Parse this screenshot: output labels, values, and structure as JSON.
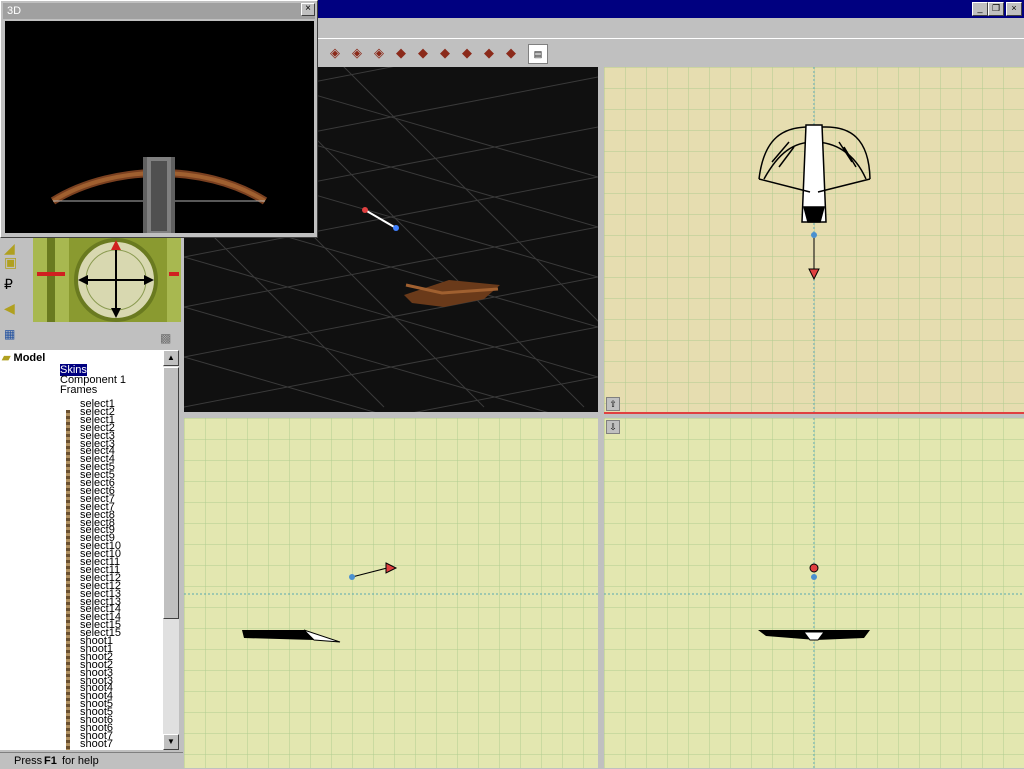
{
  "window": {
    "floating_3d_title": "3D",
    "close_glyph": "×"
  },
  "toolbar": {
    "icons": [
      "move-icon",
      "rotate-icon",
      "scale-icon",
      "vertex-icon",
      "edge-icon",
      "face-icon",
      "bone-icon",
      "tag-icon",
      "animate-icon",
      "document-icon"
    ]
  },
  "tree": {
    "root": "Model",
    "items": [
      {
        "label": "Skins",
        "selected": true
      },
      {
        "label": "Component 1"
      },
      {
        "label": "Frames"
      },
      {
        "label": "select1"
      },
      {
        "label": "select2"
      },
      {
        "label": "select1"
      },
      {
        "label": "select2"
      },
      {
        "label": "select3"
      },
      {
        "label": "select3"
      },
      {
        "label": "select4"
      },
      {
        "label": "select4"
      },
      {
        "label": "select5"
      },
      {
        "label": "select5"
      },
      {
        "label": "select6"
      },
      {
        "label": "select6"
      },
      {
        "label": "select7"
      },
      {
        "label": "select7"
      },
      {
        "label": "select8"
      },
      {
        "label": "select8"
      },
      {
        "label": "select9"
      },
      {
        "label": "select9"
      },
      {
        "label": "select10"
      },
      {
        "label": "select10"
      },
      {
        "label": "select11"
      },
      {
        "label": "select11"
      },
      {
        "label": "select12"
      },
      {
        "label": "select12"
      },
      {
        "label": "select13"
      },
      {
        "label": "select13"
      },
      {
        "label": "select14"
      },
      {
        "label": "select14"
      },
      {
        "label": "select15"
      },
      {
        "label": "select15"
      },
      {
        "label": "shoot1"
      },
      {
        "label": "shoot1"
      },
      {
        "label": "shoot2"
      },
      {
        "label": "shoot2"
      },
      {
        "label": "shoot3"
      },
      {
        "label": "shoot3"
      },
      {
        "label": "shoot4"
      },
      {
        "label": "shoot4"
      },
      {
        "label": "shoot5"
      },
      {
        "label": "shoot5"
      },
      {
        "label": "shoot6"
      },
      {
        "label": "shoot6"
      },
      {
        "label": "shoot7"
      },
      {
        "label": "shoot7"
      }
    ]
  },
  "status": {
    "prefix": "Press",
    "key": "F1",
    "suffix": "for help"
  },
  "colors": {
    "titlebar": "#000080",
    "top_view_bg": "#e6ddb0",
    "front_view_bg": "#e3e7b0",
    "persp_bg": "#101010"
  }
}
